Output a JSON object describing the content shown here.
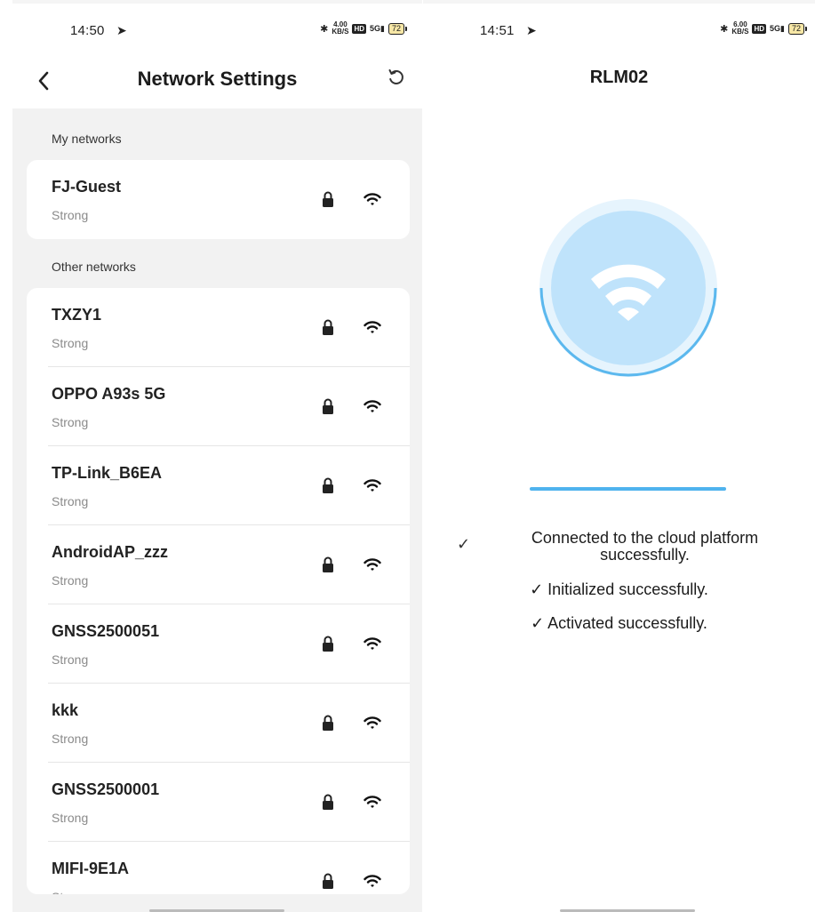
{
  "left": {
    "status": {
      "time": "14:50",
      "speed_value": "4.00",
      "speed_unit": "KB/S",
      "hd": "HD",
      "signal": "5G",
      "battery": "72"
    },
    "header": {
      "title": "Network Settings"
    },
    "my_networks": {
      "label": "My networks",
      "items": [
        {
          "name": "FJ-Guest",
          "strength": "Strong"
        }
      ]
    },
    "other_networks": {
      "label": "Other networks",
      "items": [
        {
          "name": "TXZY1",
          "strength": "Strong"
        },
        {
          "name": "OPPO A93s 5G",
          "strength": "Strong"
        },
        {
          "name": "TP-Link_B6EA",
          "strength": "Strong"
        },
        {
          "name": "AndroidAP_zzz",
          "strength": "Strong"
        },
        {
          "name": "GNSS2500051",
          "strength": "Strong"
        },
        {
          "name": "kkk",
          "strength": "Strong"
        },
        {
          "name": "GNSS2500001",
          "strength": "Strong"
        },
        {
          "name": "MIFI-9E1A",
          "strength": "Strong"
        }
      ]
    }
  },
  "right": {
    "status": {
      "time": "14:51",
      "speed_value": "6.00",
      "speed_unit": "KB/S",
      "hd": "HD",
      "signal": "5G",
      "battery": "72"
    },
    "title": "RLM02",
    "progress": 1.0,
    "steps": {
      "cloud_line1": "Connected to the cloud platform",
      "cloud_line2": "successfully.",
      "initialized": "✓ Initialized successfully.",
      "activated": "✓ Activated successfully."
    },
    "check_glyph": "✓"
  },
  "colors": {
    "accent": "#4fb3ee",
    "circle_fill": "#bfe3fb",
    "page_bg": "#f2f2f2",
    "muted_text": "#8a8a8a"
  },
  "icons": {
    "back": "chevron-left-icon",
    "refresh": "refresh-icon",
    "lock": "lock-icon",
    "wifi": "wifi-icon"
  }
}
